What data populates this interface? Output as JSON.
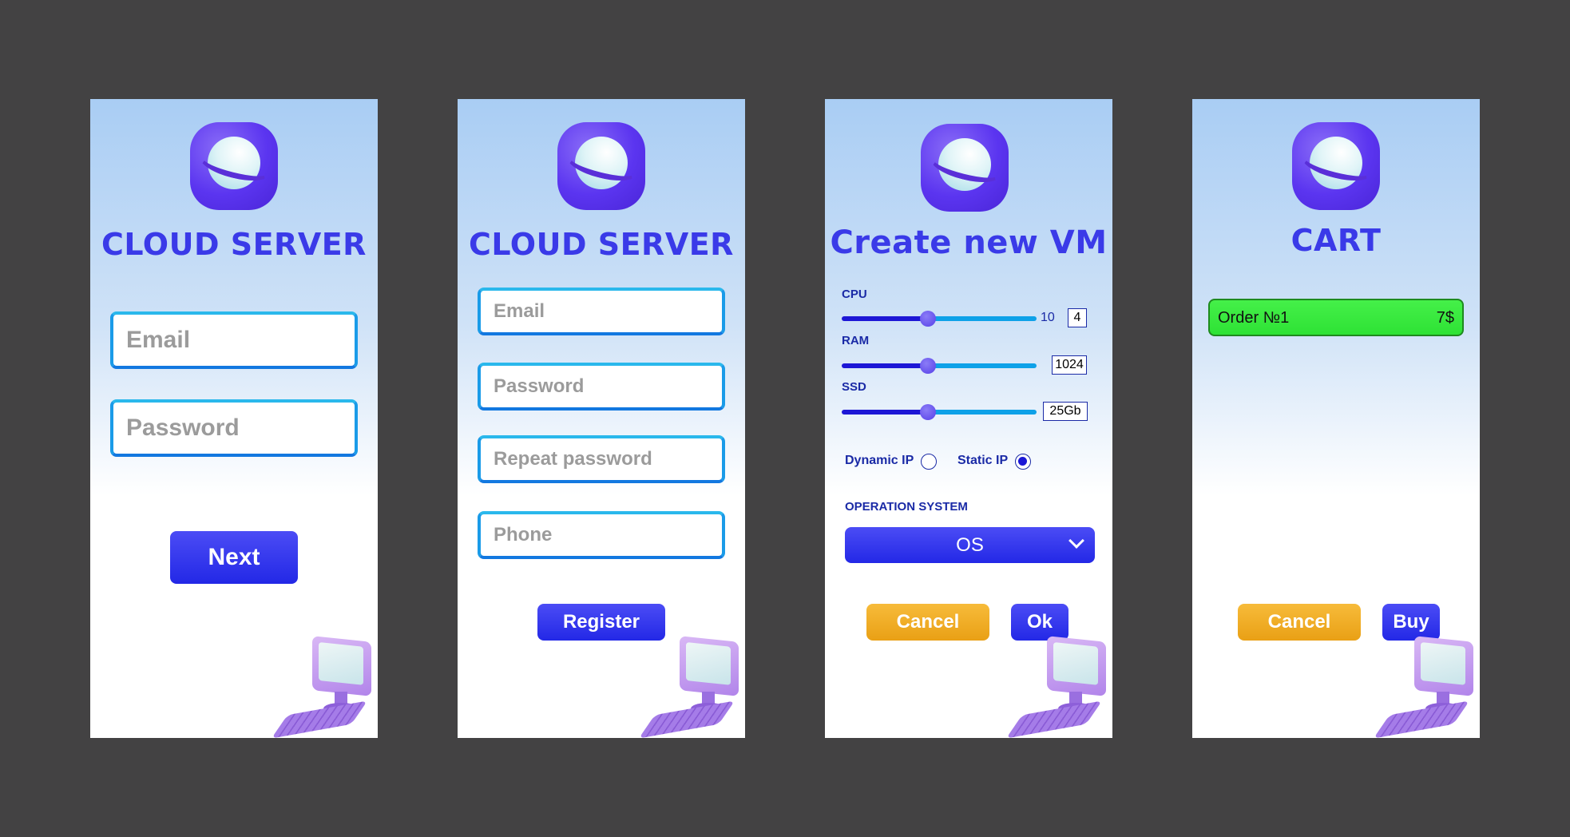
{
  "colors": {
    "background": "#434243",
    "title": "#3a3ae8",
    "primary_button": "#2328e6",
    "secondary_button": "#e9a015",
    "field_border": "#1a9be8",
    "order_item": "#2ee235"
  },
  "icons": {
    "logo": "planet-logo-icon",
    "illustration": "desktop-computer-icon",
    "dropdown": "chevron-down-icon"
  },
  "login": {
    "title": "CLOUD SERVER",
    "email_placeholder": "Email",
    "password_placeholder": "Password",
    "next_label": "Next"
  },
  "register": {
    "title": "CLOUD SERVER",
    "email_placeholder": "Email",
    "password_placeholder": "Password",
    "repeat_password_placeholder": "Repeat password",
    "phone_placeholder": "Phone",
    "register_label": "Register"
  },
  "create_vm": {
    "title": "Create new VM",
    "cpu": {
      "label": "CPU",
      "max_label": "10",
      "value": "4"
    },
    "ram": {
      "label": "RAM",
      "value": "1024"
    },
    "ssd": {
      "label": "SSD",
      "value": "25Gb"
    },
    "dynamic_ip_label": "Dynamic IP",
    "static_ip_label": "Static IP",
    "selected_ip": "Static IP",
    "os_section_label": "OPERATION SYSTEM",
    "os_selected": "OS",
    "cancel_label": "Cancel",
    "ok_label": "Ok"
  },
  "cart": {
    "title": "CART",
    "orders": [
      {
        "name": "Order №1",
        "price": "7$"
      }
    ],
    "cancel_label": "Cancel",
    "buy_label": "Buy"
  }
}
